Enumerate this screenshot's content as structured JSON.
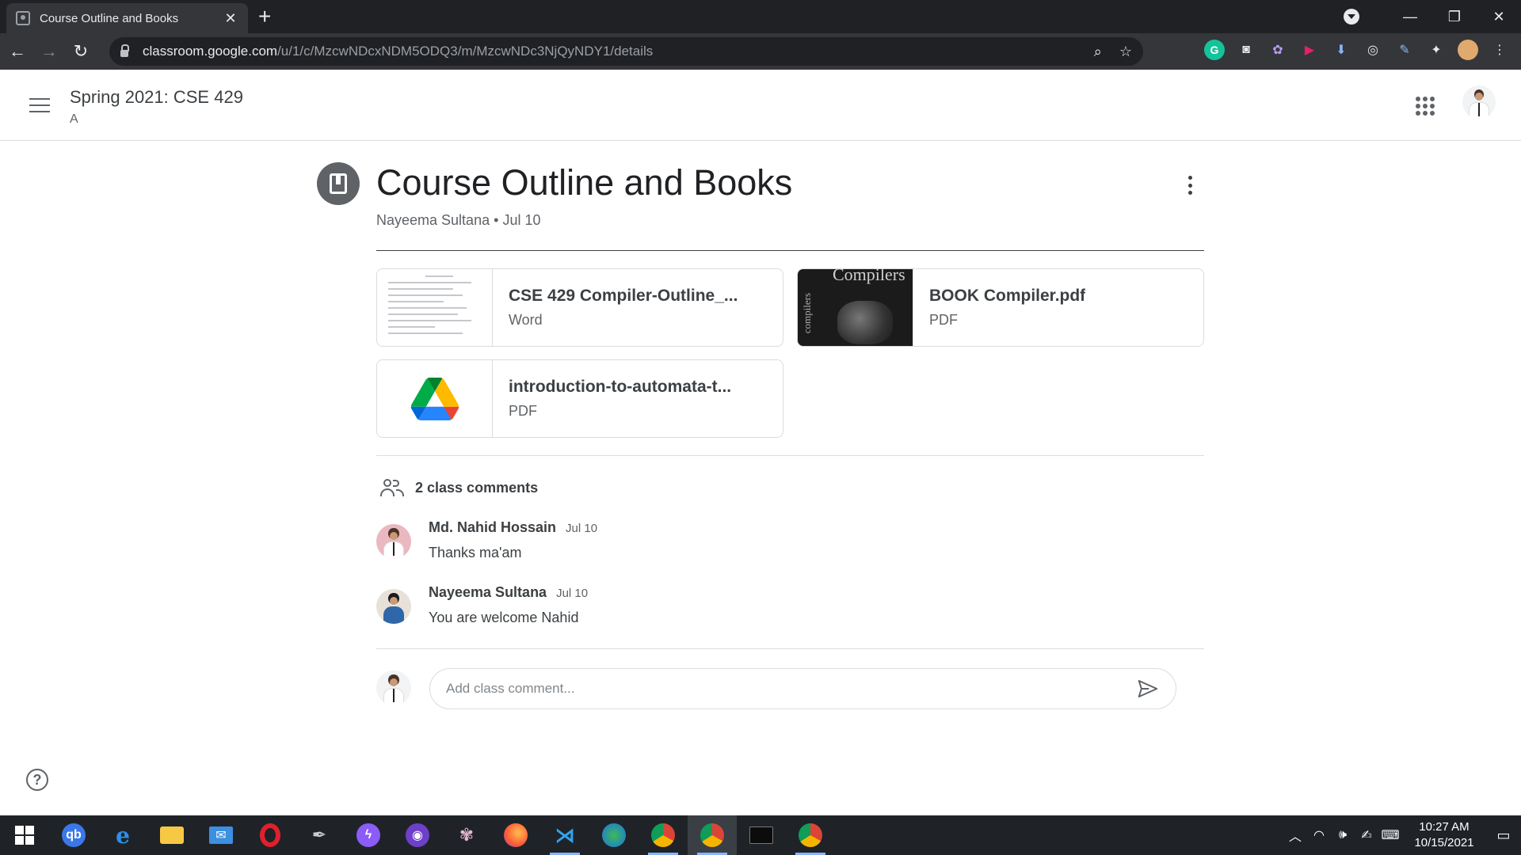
{
  "browser": {
    "tab_title": "Course Outline and Books",
    "url_host": "classroom.google.com",
    "url_path": "/u/1/c/MzcwNDcxNDM5ODQ3/m/MzcwNDc3NjQyNDY1/details"
  },
  "header": {
    "class_title": "Spring 2021: CSE 429",
    "class_section": "A"
  },
  "post": {
    "title": "Course Outline and Books",
    "author": "Nayeema Sultana",
    "separator": "•",
    "date": "Jul 10"
  },
  "attachments": [
    {
      "name": "CSE 429 Compiler-Outline_...",
      "type": "Word"
    },
    {
      "name": "BOOK Compiler.pdf",
      "type": "PDF",
      "thumb_title": "Compilers",
      "thumb_side": "compilers"
    },
    {
      "name": "introduction-to-automata-t...",
      "type": "PDF"
    }
  ],
  "comments": {
    "count_label": "2 class comments",
    "items": [
      {
        "author": "Md. Nahid Hossain",
        "date": "Jul 10",
        "text": "Thanks ma'am"
      },
      {
        "author": "Nayeema Sultana",
        "date": "Jul 10",
        "text": "You are welcome Nahid"
      }
    ],
    "placeholder": "Add class comment..."
  },
  "taskbar": {
    "time": "10:27 AM",
    "date": "10/15/2021"
  },
  "colors": {
    "drive_green": "#1fa463",
    "drive_yellow": "#ffd04b",
    "drive_blue": "#4688f4",
    "chrome_dark": "#202124"
  },
  "icons": [
    "tab-favicon-icon",
    "close-icon",
    "plus-icon",
    "back-icon",
    "forward-icon",
    "reload-icon",
    "lock-icon",
    "zoom-icon",
    "star-icon",
    "extensions-icon",
    "menu-icon",
    "apps-grid-icon",
    "book-icon",
    "more-vert-icon",
    "people-icon",
    "send-icon",
    "help-icon",
    "google-drive-icon"
  ]
}
